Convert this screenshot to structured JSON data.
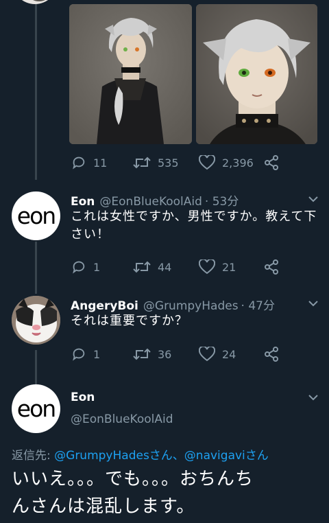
{
  "tweet1": {
    "reply_count": "11",
    "retweet_count": "535",
    "like_count": "2,396"
  },
  "tweet2": {
    "name": "Eon",
    "handle": "@EonBlueKoolAid",
    "time": "· 53分",
    "text": "これは女性ですか、男性ですか。教えて下さい！",
    "reply_count": "1",
    "retweet_count": "44",
    "like_count": "21"
  },
  "tweet3": {
    "name": "AngeryBoi",
    "handle": "@GrumpyHades",
    "time": "· 47分",
    "text": "それは重要ですか？",
    "reply_count": "1",
    "retweet_count": "36",
    "like_count": "24"
  },
  "main_tweet": {
    "name": "Eon",
    "handle": "@EonBlueKoolAid",
    "reply_to_label": "返信先:",
    "reply_to_user1": "@GrumpyHadesさん",
    "reply_to_sep": "、",
    "reply_to_user2": "@navigaviさん",
    "text_line1": "いいえ。。。でも。。。おちんち",
    "text_line2": "んさんは混乱します。"
  },
  "avatar_logo_text": "eon",
  "colors": {
    "background": "#15202b",
    "secondary_text": "#8899a6",
    "link": "#1da1f2",
    "thread_line": "#38444d"
  }
}
